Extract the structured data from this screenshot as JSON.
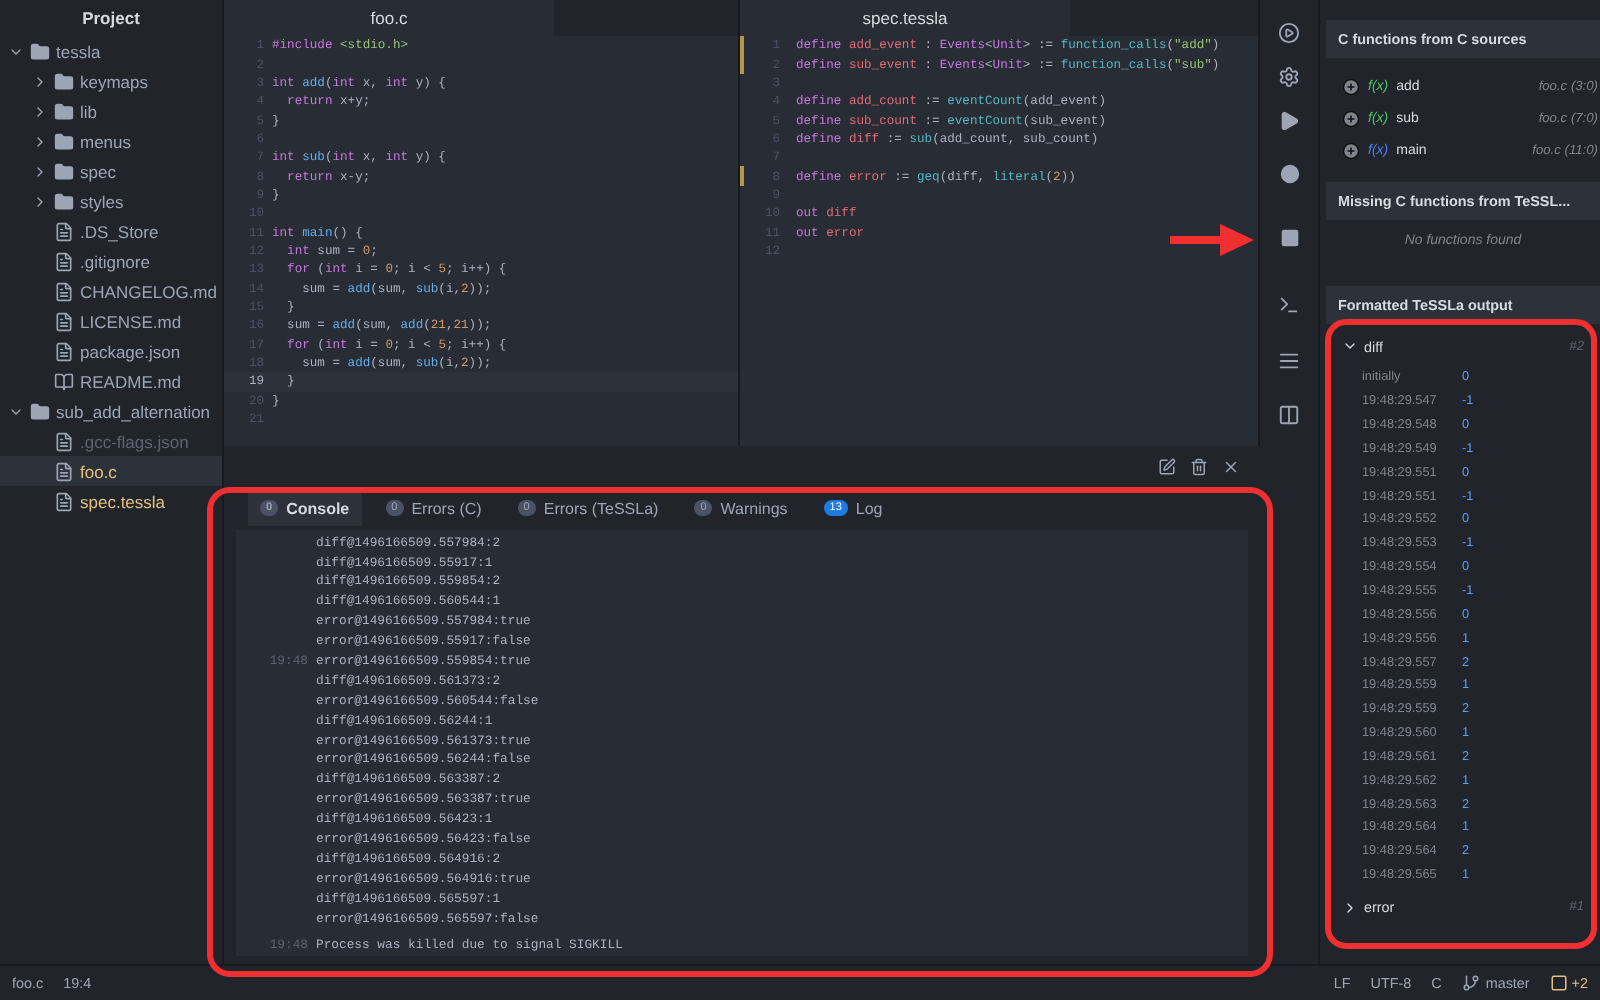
{
  "sidebar": {
    "title": "Project",
    "tree": [
      {
        "name": "tessla",
        "kind": "folder",
        "expanded": true,
        "selected": false,
        "children": [
          {
            "name": "keymaps",
            "kind": "folder",
            "expanded": false,
            "selected": false
          },
          {
            "name": "lib",
            "kind": "folder",
            "expanded": false,
            "selected": false
          },
          {
            "name": "menus",
            "kind": "folder",
            "expanded": false,
            "selected": false
          },
          {
            "name": "spec",
            "kind": "folder",
            "expanded": false,
            "selected": false
          },
          {
            "name": "styles",
            "kind": "folder",
            "expanded": false,
            "selected": false
          },
          {
            "name": ".DS_Store",
            "kind": "file",
            "selected": false
          },
          {
            "name": ".gitignore",
            "kind": "file",
            "selected": false
          },
          {
            "name": "CHANGELOG.md",
            "kind": "file",
            "selected": false
          },
          {
            "name": "LICENSE.md",
            "kind": "file",
            "selected": false
          },
          {
            "name": "package.json",
            "kind": "file",
            "selected": false
          },
          {
            "name": "README.md",
            "kind": "readme",
            "selected": false
          }
        ]
      },
      {
        "name": "sub_add_alternation",
        "kind": "folder",
        "expanded": true,
        "selected": false,
        "children": [
          {
            "name": ".gcc-flags.json",
            "kind": "file",
            "ignored": true,
            "modified": false,
            "selected": false
          },
          {
            "name": "foo.c",
            "kind": "file",
            "ignored": false,
            "modified": true,
            "selected": true
          },
          {
            "name": "spec.tessla",
            "kind": "file",
            "ignored": false,
            "modified": true,
            "selected": false
          }
        ]
      }
    ]
  },
  "editors": [
    {
      "tab": {
        "label": "foo.c",
        "selected": true
      },
      "lines": [
        {
          "n": "1",
          "changed": false,
          "current": false,
          "tokens": [
            {
              "kind": "keyword",
              "text": "#include"
            },
            {
              "kind": "string",
              "text": " <stdio.h>"
            }
          ]
        },
        {
          "n": "2",
          "changed": false,
          "current": false
        },
        {
          "n": "3",
          "changed": false,
          "current": false,
          "tokens": [
            {
              "kind": "keyword",
              "text": "int"
            },
            {
              "kind": "function",
              "text": " add"
            },
            {
              "kind": "plain",
              "text": "("
            },
            {
              "kind": "keyword",
              "text": "int"
            },
            {
              "kind": "plain",
              "text": " x, "
            },
            {
              "kind": "keyword",
              "text": "int"
            },
            {
              "kind": "plain",
              "text": " y) {"
            }
          ]
        },
        {
          "n": "4",
          "changed": false,
          "current": false,
          "tokens": [
            {
              "kind": "keyword",
              "text": "  return"
            },
            {
              "kind": "plain",
              "text": " x+y;"
            }
          ]
        },
        {
          "n": "5",
          "changed": false,
          "current": false,
          "tokens": [
            {
              "kind": "plain",
              "text": "}"
            }
          ]
        },
        {
          "n": "6",
          "changed": false,
          "current": false
        },
        {
          "n": "7",
          "changed": false,
          "current": false,
          "tokens": [
            {
              "kind": "keyword",
              "text": "int"
            },
            {
              "kind": "function",
              "text": " sub"
            },
            {
              "kind": "plain",
              "text": "("
            },
            {
              "kind": "keyword",
              "text": "int"
            },
            {
              "kind": "plain",
              "text": " x, "
            },
            {
              "kind": "keyword",
              "text": "int"
            },
            {
              "kind": "plain",
              "text": " y) {"
            }
          ]
        },
        {
          "n": "8",
          "changed": false,
          "current": false,
          "tokens": [
            {
              "kind": "keyword",
              "text": "  return"
            },
            {
              "kind": "plain",
              "text": " x-y;"
            }
          ]
        },
        {
          "n": "9",
          "changed": false,
          "current": false,
          "tokens": [
            {
              "kind": "plain",
              "text": "}"
            }
          ]
        },
        {
          "n": "10",
          "changed": false,
          "current": false
        },
        {
          "n": "11",
          "changed": false,
          "current": false,
          "tokens": [
            {
              "kind": "keyword",
              "text": "int"
            },
            {
              "kind": "function",
              "text": " main"
            },
            {
              "kind": "plain",
              "text": "() {"
            }
          ]
        },
        {
          "n": "12",
          "changed": false,
          "current": false,
          "tokens": [
            {
              "kind": "keyword",
              "text": "  int"
            },
            {
              "kind": "plain",
              "text": " sum = "
            },
            {
              "kind": "number",
              "text": "0"
            },
            {
              "kind": "plain",
              "text": ";"
            }
          ]
        },
        {
          "n": "13",
          "changed": false,
          "current": false,
          "tokens": [
            {
              "kind": "keyword",
              "text": "  for"
            },
            {
              "kind": "plain",
              "text": " ("
            },
            {
              "kind": "keyword",
              "text": "int"
            },
            {
              "kind": "plain",
              "text": " i = "
            },
            {
              "kind": "number",
              "text": "0"
            },
            {
              "kind": "plain",
              "text": "; i < "
            },
            {
              "kind": "number",
              "text": "5"
            },
            {
              "kind": "plain",
              "text": "; i++) {"
            }
          ]
        },
        {
          "n": "14",
          "changed": false,
          "current": false,
          "tokens": [
            {
              "kind": "plain",
              "text": "    sum = "
            },
            {
              "kind": "function",
              "text": "add"
            },
            {
              "kind": "plain",
              "text": "(sum, "
            },
            {
              "kind": "function",
              "text": "sub"
            },
            {
              "kind": "plain",
              "text": "(i,"
            },
            {
              "kind": "number",
              "text": "2"
            },
            {
              "kind": "plain",
              "text": "));"
            }
          ]
        },
        {
          "n": "15",
          "changed": false,
          "current": false,
          "tokens": [
            {
              "kind": "plain",
              "text": "  }"
            }
          ]
        },
        {
          "n": "16",
          "changed": false,
          "current": false,
          "tokens": [
            {
              "kind": "plain",
              "text": "  sum = "
            },
            {
              "kind": "function",
              "text": "add"
            },
            {
              "kind": "plain",
              "text": "(sum, "
            },
            {
              "kind": "function",
              "text": "add"
            },
            {
              "kind": "plain",
              "text": "("
            },
            {
              "kind": "number",
              "text": "21"
            },
            {
              "kind": "plain",
              "text": ","
            },
            {
              "kind": "number",
              "text": "21"
            },
            {
              "kind": "plain",
              "text": "));"
            }
          ]
        },
        {
          "n": "17",
          "changed": false,
          "current": false,
          "tokens": [
            {
              "kind": "keyword",
              "text": "  for"
            },
            {
              "kind": "plain",
              "text": " ("
            },
            {
              "kind": "keyword",
              "text": "int"
            },
            {
              "kind": "plain",
              "text": " i = "
            },
            {
              "kind": "number",
              "text": "0"
            },
            {
              "kind": "plain",
              "text": "; i < "
            },
            {
              "kind": "number",
              "text": "5"
            },
            {
              "kind": "plain",
              "text": "; i++) {"
            }
          ]
        },
        {
          "n": "18",
          "changed": false,
          "current": false,
          "tokens": [
            {
              "kind": "plain",
              "text": "    sum = "
            },
            {
              "kind": "function",
              "text": "add"
            },
            {
              "kind": "plain",
              "text": "(sum, "
            },
            {
              "kind": "function",
              "text": "sub"
            },
            {
              "kind": "plain",
              "text": "(i,"
            },
            {
              "kind": "number",
              "text": "2"
            },
            {
              "kind": "plain",
              "text": "));"
            }
          ]
        },
        {
          "n": "19",
          "changed": false,
          "current": true,
          "tokens": [
            {
              "kind": "plain",
              "text": "  }"
            }
          ]
        },
        {
          "n": "20",
          "changed": false,
          "current": false,
          "tokens": [
            {
              "kind": "plain",
              "text": "}"
            }
          ]
        },
        {
          "n": "21",
          "changed": false,
          "current": false
        }
      ]
    },
    {
      "tab": {
        "label": "spec.tessla",
        "selected": true
      },
      "lines": [
        {
          "n": "1",
          "changed": true,
          "current": false,
          "tokens": [
            {
              "kind": "keyword",
              "text": "define"
            },
            {
              "kind": "variable",
              "text": " add_event"
            },
            {
              "kind": "plain",
              "text": " : "
            },
            {
              "kind": "keyword",
              "text": "Events"
            },
            {
              "kind": "plain",
              "text": "<"
            },
            {
              "kind": "keyword",
              "text": "Unit"
            },
            {
              "kind": "plain",
              "text": "> := "
            },
            {
              "kind": "builtin",
              "text": "function_calls"
            },
            {
              "kind": "plain",
              "text": "("
            },
            {
              "kind": "string",
              "text": "\"add\""
            },
            {
              "kind": "plain",
              "text": ")"
            }
          ]
        },
        {
          "n": "2",
          "changed": true,
          "current": false,
          "tokens": [
            {
              "kind": "keyword",
              "text": "define"
            },
            {
              "kind": "variable",
              "text": " sub_event"
            },
            {
              "kind": "plain",
              "text": " : "
            },
            {
              "kind": "keyword",
              "text": "Events"
            },
            {
              "kind": "plain",
              "text": "<"
            },
            {
              "kind": "keyword",
              "text": "Unit"
            },
            {
              "kind": "plain",
              "text": "> := "
            },
            {
              "kind": "builtin",
              "text": "function_calls"
            },
            {
              "kind": "plain",
              "text": "("
            },
            {
              "kind": "string",
              "text": "\"sub\""
            },
            {
              "kind": "plain",
              "text": ")"
            }
          ]
        },
        {
          "n": "3",
          "changed": false,
          "current": false
        },
        {
          "n": "4",
          "changed": false,
          "current": false,
          "tokens": [
            {
              "kind": "keyword",
              "text": "define"
            },
            {
              "kind": "variable",
              "text": " add_count"
            },
            {
              "kind": "plain",
              "text": " := "
            },
            {
              "kind": "builtin",
              "text": "eventCount"
            },
            {
              "kind": "plain",
              "text": "(add_event)"
            }
          ]
        },
        {
          "n": "5",
          "changed": false,
          "current": false,
          "tokens": [
            {
              "kind": "keyword",
              "text": "define"
            },
            {
              "kind": "variable",
              "text": " sub_count"
            },
            {
              "kind": "plain",
              "text": " := "
            },
            {
              "kind": "builtin",
              "text": "eventCount"
            },
            {
              "kind": "plain",
              "text": "(sub_event)"
            }
          ]
        },
        {
          "n": "6",
          "changed": false,
          "current": false,
          "tokens": [
            {
              "kind": "keyword",
              "text": "define"
            },
            {
              "kind": "variable",
              "text": " diff"
            },
            {
              "kind": "plain",
              "text": " := "
            },
            {
              "kind": "builtin",
              "text": "sub"
            },
            {
              "kind": "plain",
              "text": "(add_count, sub_count)"
            }
          ]
        },
        {
          "n": "7",
          "changed": false,
          "current": false
        },
        {
          "n": "8",
          "changed": true,
          "current": false,
          "tokens": [
            {
              "kind": "keyword",
              "text": "define"
            },
            {
              "kind": "variable",
              "text": " error"
            },
            {
              "kind": "plain",
              "text": " := "
            },
            {
              "kind": "builtin",
              "text": "geq"
            },
            {
              "kind": "plain",
              "text": "(diff, "
            },
            {
              "kind": "builtin",
              "text": "literal"
            },
            {
              "kind": "plain",
              "text": "("
            },
            {
              "kind": "number",
              "text": "2"
            },
            {
              "kind": "plain",
              "text": "))"
            }
          ]
        },
        {
          "n": "9",
          "changed": false,
          "current": false
        },
        {
          "n": "10",
          "changed": false,
          "current": false,
          "tokens": [
            {
              "kind": "keyword",
              "text": "out"
            },
            {
              "kind": "variable",
              "text": " diff"
            }
          ]
        },
        {
          "n": "11",
          "changed": false,
          "current": false,
          "tokens": [
            {
              "kind": "keyword",
              "text": "out"
            },
            {
              "kind": "variable",
              "text": " error"
            }
          ]
        },
        {
          "n": "12",
          "changed": false,
          "current": false
        }
      ]
    }
  ],
  "console": {
    "tabs": [
      {
        "label": "Console",
        "count": "0",
        "alert": false,
        "selected": true
      },
      {
        "label": "Errors (C)",
        "count": "0",
        "alert": false,
        "selected": false
      },
      {
        "label": "Errors (TeSSLa)",
        "count": "0",
        "alert": false,
        "selected": false
      },
      {
        "label": "Warnings",
        "count": "0",
        "alert": false,
        "selected": false
      },
      {
        "label": "Log",
        "count": "13",
        "alert": true,
        "selected": false
      }
    ],
    "lines": [
      {
        "text": "diff@1496166509.557984:2"
      },
      {
        "text": "diff@1496166509.55917:1"
      },
      {
        "text": "diff@1496166509.559854:2"
      },
      {
        "text": "diff@1496166509.560544:1"
      },
      {
        "text": "error@1496166509.557984:true"
      },
      {
        "text": "error@1496166509.55917:false"
      },
      {
        "time": "19:48",
        "text": "error@1496166509.559854:true"
      },
      {
        "text": "diff@1496166509.561373:2"
      },
      {
        "text": "error@1496166509.560544:false"
      },
      {
        "text": "diff@1496166509.56244:1"
      },
      {
        "text": "error@1496166509.561373:true"
      },
      {
        "text": "error@1496166509.56244:false"
      },
      {
        "text": "diff@1496166509.563387:2"
      },
      {
        "text": "error@1496166509.563387:true"
      },
      {
        "text": "diff@1496166509.56423:1"
      },
      {
        "text": "error@1496166509.56423:false"
      },
      {
        "text": "diff@1496166509.564916:2"
      },
      {
        "text": "error@1496166509.564916:true"
      },
      {
        "text": "diff@1496166509.565597:1"
      },
      {
        "text": "error@1496166509.565597:false"
      }
    ],
    "final": {
      "time": "19:48",
      "text": "Process was killed due to signal SIGKILL"
    }
  },
  "panel": {
    "functions": {
      "title": "C functions from C sources",
      "items": [
        {
          "name": "add",
          "icon": "f(x)",
          "color": "#4ec26a",
          "location": "foo.c (3:0)"
        },
        {
          "name": "sub",
          "icon": "f(x)",
          "color": "#4ec26a",
          "location": "foo.c (7:0)"
        },
        {
          "name": "main",
          "icon": "f(x)",
          "color": "#4d7ff0",
          "location": "foo.c (11:0)"
        }
      ]
    },
    "missing": {
      "title": "Missing C functions from TeSSL...",
      "empty": "No functions found"
    },
    "output": {
      "title": "Formatted TeSSLa output",
      "streams": [
        {
          "name": "diff",
          "count": "#2",
          "expanded": true,
          "rows": [
            [
              "initially",
              "0"
            ],
            [
              "19:48:29.547",
              "-1"
            ],
            [
              "19:48:29.548",
              "0"
            ],
            [
              "19:48:29.549",
              "-1"
            ],
            [
              "19:48:29.551",
              "0"
            ],
            [
              "19:48:29.551",
              "-1"
            ],
            [
              "19:48:29.552",
              "0"
            ],
            [
              "19:48:29.553",
              "-1"
            ],
            [
              "19:48:29.554",
              "0"
            ],
            [
              "19:48:29.555",
              "-1"
            ],
            [
              "19:48:29.556",
              "0"
            ],
            [
              "19:48:29.556",
              "1"
            ],
            [
              "19:48:29.557",
              "2"
            ],
            [
              "19:48:29.559",
              "1"
            ],
            [
              "19:48:29.559",
              "2"
            ],
            [
              "19:48:29.560",
              "1"
            ],
            [
              "19:48:29.561",
              "2"
            ],
            [
              "19:48:29.562",
              "1"
            ],
            [
              "19:48:29.563",
              "2"
            ],
            [
              "19:48:29.564",
              "1"
            ],
            [
              "19:48:29.564",
              "2"
            ],
            [
              "19:48:29.565",
              "1"
            ]
          ]
        },
        {
          "name": "error",
          "count": "#1",
          "expanded": false
        }
      ]
    }
  },
  "status_bar": {
    "file": "foo.c",
    "cursor": "19:4",
    "line_ending": "LF",
    "encoding": "UTF-8",
    "grammar": "C",
    "branch": "master",
    "changes": "+2"
  }
}
